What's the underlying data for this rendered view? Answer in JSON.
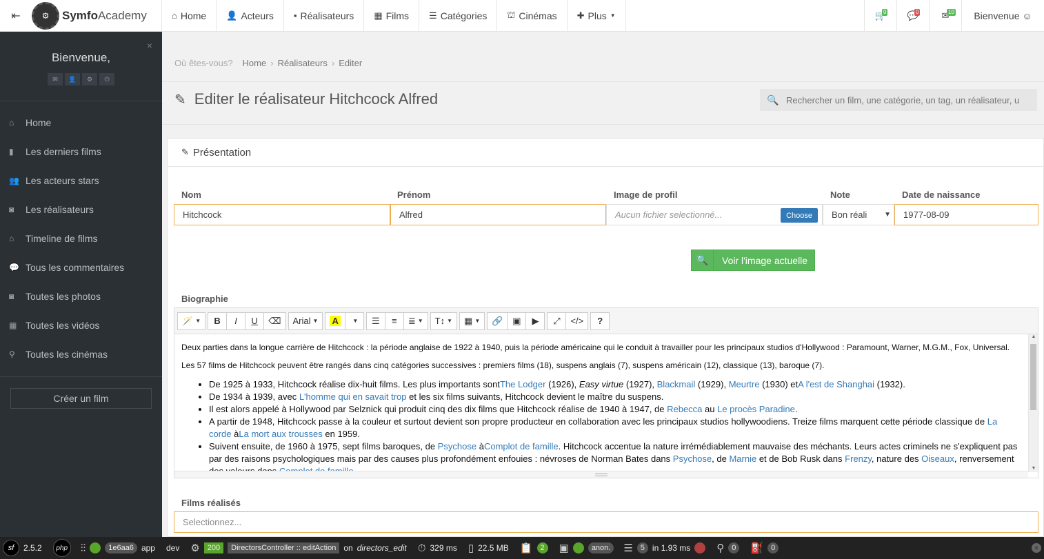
{
  "brand": {
    "name_bold": "Symfo",
    "name_light": "Academy"
  },
  "nav": {
    "items": [
      {
        "icon": "home-icon",
        "glyph": "⌂",
        "label": "Home"
      },
      {
        "icon": "user-icon",
        "glyph": "👤",
        "label": "Acteurs"
      },
      {
        "icon": "video-camera-icon",
        "glyph": "▪",
        "label": "Réalisateurs"
      },
      {
        "icon": "film-icon",
        "glyph": "▦",
        "label": "Films"
      },
      {
        "icon": "list-icon",
        "glyph": "☰",
        "label": "Catégories"
      },
      {
        "icon": "cinema-icon",
        "glyph": "⛫",
        "label": "Cinémas"
      },
      {
        "icon": "plus-icon",
        "glyph": "✚",
        "label": "Plus"
      }
    ],
    "cart_badge": "0",
    "comments_badge": "0",
    "inbox_badge": "10",
    "welcome": "Bienvenue ☺"
  },
  "sidebar": {
    "welcome": "Bienvenue,",
    "items": [
      {
        "icon": "home-icon",
        "glyph": "⌂",
        "label": "Home"
      },
      {
        "icon": "bookmark-icon",
        "glyph": "▮",
        "label": "Les derniers films"
      },
      {
        "icon": "users-icon",
        "glyph": "👥",
        "label": "Les acteurs stars"
      },
      {
        "icon": "camera-icon",
        "glyph": "◙",
        "label": "Les réalisateurs"
      },
      {
        "icon": "home-icon",
        "glyph": "⌂",
        "label": "Timeline de films"
      },
      {
        "icon": "comments-icon",
        "glyph": "💬",
        "label": "Tous les commentaires"
      },
      {
        "icon": "camera-icon",
        "glyph": "◙",
        "label": "Toutes les photos"
      },
      {
        "icon": "film-icon",
        "glyph": "▦",
        "label": "Toutes les vidéos"
      },
      {
        "icon": "map-marker-icon",
        "glyph": "⚲",
        "label": "Toutes les cinémas"
      }
    ],
    "create": "Créer un film"
  },
  "breadcrumb": {
    "prefix": "Où êtes-vous?",
    "items": [
      "Home",
      "Réalisateurs",
      "Editer"
    ]
  },
  "page": {
    "title": "Editer le réalisateur Hitchcock Alfred",
    "search_placeholder": "Rechercher un film, une catégorie, un tag, un réalisateur, u"
  },
  "form": {
    "panel_title": "Présentation",
    "nom_label": "Nom",
    "nom_value": "Hitchcock",
    "prenom_label": "Prénom",
    "prenom_value": "Alfred",
    "image_label": "Image de profil",
    "image_placeholder": "Aucun fichier selectionné...",
    "choose": "Choose",
    "note_label": "Note",
    "note_value": "Bon réali",
    "date_label": "Date de naissance",
    "date_value": "1977-08-09",
    "voir": "Voir l'image actuelle",
    "bio_label": "Biographie",
    "films_label": "Films réalisés",
    "films_placeholder": "Selectionnez..."
  },
  "editor": {
    "font": "Arial",
    "p1": "Deux parties dans la longue carrière de Hitchcock : la période anglaise de 1922 à 1940, puis la période américaine qui le conduit à travailler pour les principaux studios d'Hollywood : Paramount, Warner, M.G.M., Fox, Universal.",
    "p2": "Les 57 films de Hitchcock peuvent être rangés dans cinq catégories successives : premiers films (18), suspens anglais (7), suspens américain (12), classique (13), baroque (7).",
    "li1": [
      "De 1925 à 1933, Hitchcock réalise dix-huit films. Les plus importants sont",
      "The Lodger",
      " (1926), ",
      "Easy virtue",
      " (1927), ",
      "Blackmail",
      " (1929), ",
      "Meurtre",
      " (1930) et",
      "A l'est de Shanghai",
      " (1932)."
    ],
    "li2": [
      "De 1934 à 1939, avec ",
      "L'homme qui en savait trop",
      " et les six films suivants, Hitchcock devient le maître du suspens."
    ],
    "li3": [
      "Il est alors appelé à Hollywood par Selznick qui produit cinq des dix films que Hitchcock réalise de 1940 à 1947, de ",
      "Rebecca",
      " au ",
      "Le procès Paradine",
      "."
    ],
    "li4": [
      "A partir de 1948, Hitchcock passe à la couleur et surtout devient son propre producteur en collaboration avec les principaux studios hollywoodiens. Treize films marquent cette période classique de ",
      "La corde",
      " à",
      "La mort aux trousses",
      " en 1959."
    ],
    "li5": [
      "Suivent ensuite, de 1960 à 1975, sept films baroques, de ",
      "Psychose",
      " à",
      "Complot de famille",
      ". Hitchcock accentue la nature irrémédiablement mauvaise des méchants. Leurs actes criminels ne s'expliquent pas par des raisons psychologiques mais par des causes plus profondément enfouies : névroses de Norman Bates dans ",
      "Psychose",
      ", de ",
      "Marnie",
      " et de Bob Rusk dans ",
      "Frenzy",
      ", nature des ",
      "Oiseaux",
      ", renversement des valeurs dans ",
      "Complot de famille",
      "."
    ]
  },
  "sfbar": {
    "version": "2.5.2",
    "token": "1e6aa6",
    "app": "app",
    "env": "dev",
    "status": "200",
    "controller": "DirectorsController :: editAction",
    "route_prefix": "on",
    "route": "directors_edit",
    "time": "329 ms",
    "memory": "22.5 MB",
    "logs": "2",
    "user": "anon.",
    "queries": "5",
    "query_time": "in 1.93 ms",
    "c1": "0",
    "c2": "0"
  }
}
